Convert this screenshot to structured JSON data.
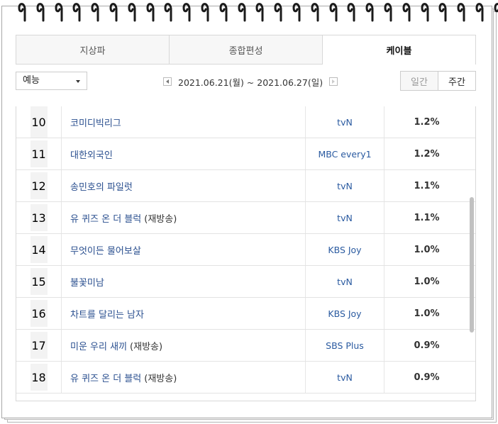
{
  "tabs": [
    {
      "label": "지상파",
      "active": false
    },
    {
      "label": "종합편성",
      "active": false
    },
    {
      "label": "케이블",
      "active": true
    }
  ],
  "filter": {
    "category": "예능",
    "date_range": "2021.06.21(월) ~ 2021.06.27(일)",
    "period_daily": "일간",
    "period_weekly": "주간",
    "active_period": "주간"
  },
  "rows": [
    {
      "rank": "10",
      "title": "코미디빅리그",
      "suffix": "",
      "channel": "tvN",
      "rating": "1.2%"
    },
    {
      "rank": "11",
      "title": "대한외국인",
      "suffix": "",
      "channel": "MBC every1",
      "rating": "1.2%"
    },
    {
      "rank": "12",
      "title": "송민호의 파일럿",
      "suffix": "",
      "channel": "tvN",
      "rating": "1.1%"
    },
    {
      "rank": "13",
      "title": "유 퀴즈 온 더 블럭",
      "suffix": "(재방송)",
      "channel": "tvN",
      "rating": "1.1%"
    },
    {
      "rank": "14",
      "title": "무엇이든 물어보살",
      "suffix": "",
      "channel": "KBS Joy",
      "rating": "1.0%"
    },
    {
      "rank": "15",
      "title": "불꽃미남",
      "suffix": "",
      "channel": "tvN",
      "rating": "1.0%"
    },
    {
      "rank": "16",
      "title": "차트를 달리는 남자",
      "suffix": "",
      "channel": "KBS Joy",
      "rating": "1.0%"
    },
    {
      "rank": "17",
      "title": "미운 우리 새끼",
      "suffix": "(재방송)",
      "channel": "SBS Plus",
      "rating": "0.9%"
    },
    {
      "rank": "18",
      "title": "유 퀴즈 온 더 블럭",
      "suffix": "(재방송)",
      "channel": "tvN",
      "rating": "0.9%"
    }
  ],
  "scroll": {
    "position": 0.57,
    "visible_fraction": 0.46
  },
  "colors": {
    "link": "#2a4f8f",
    "channel": "#2a5aa0",
    "border": "#d8d8d8"
  }
}
